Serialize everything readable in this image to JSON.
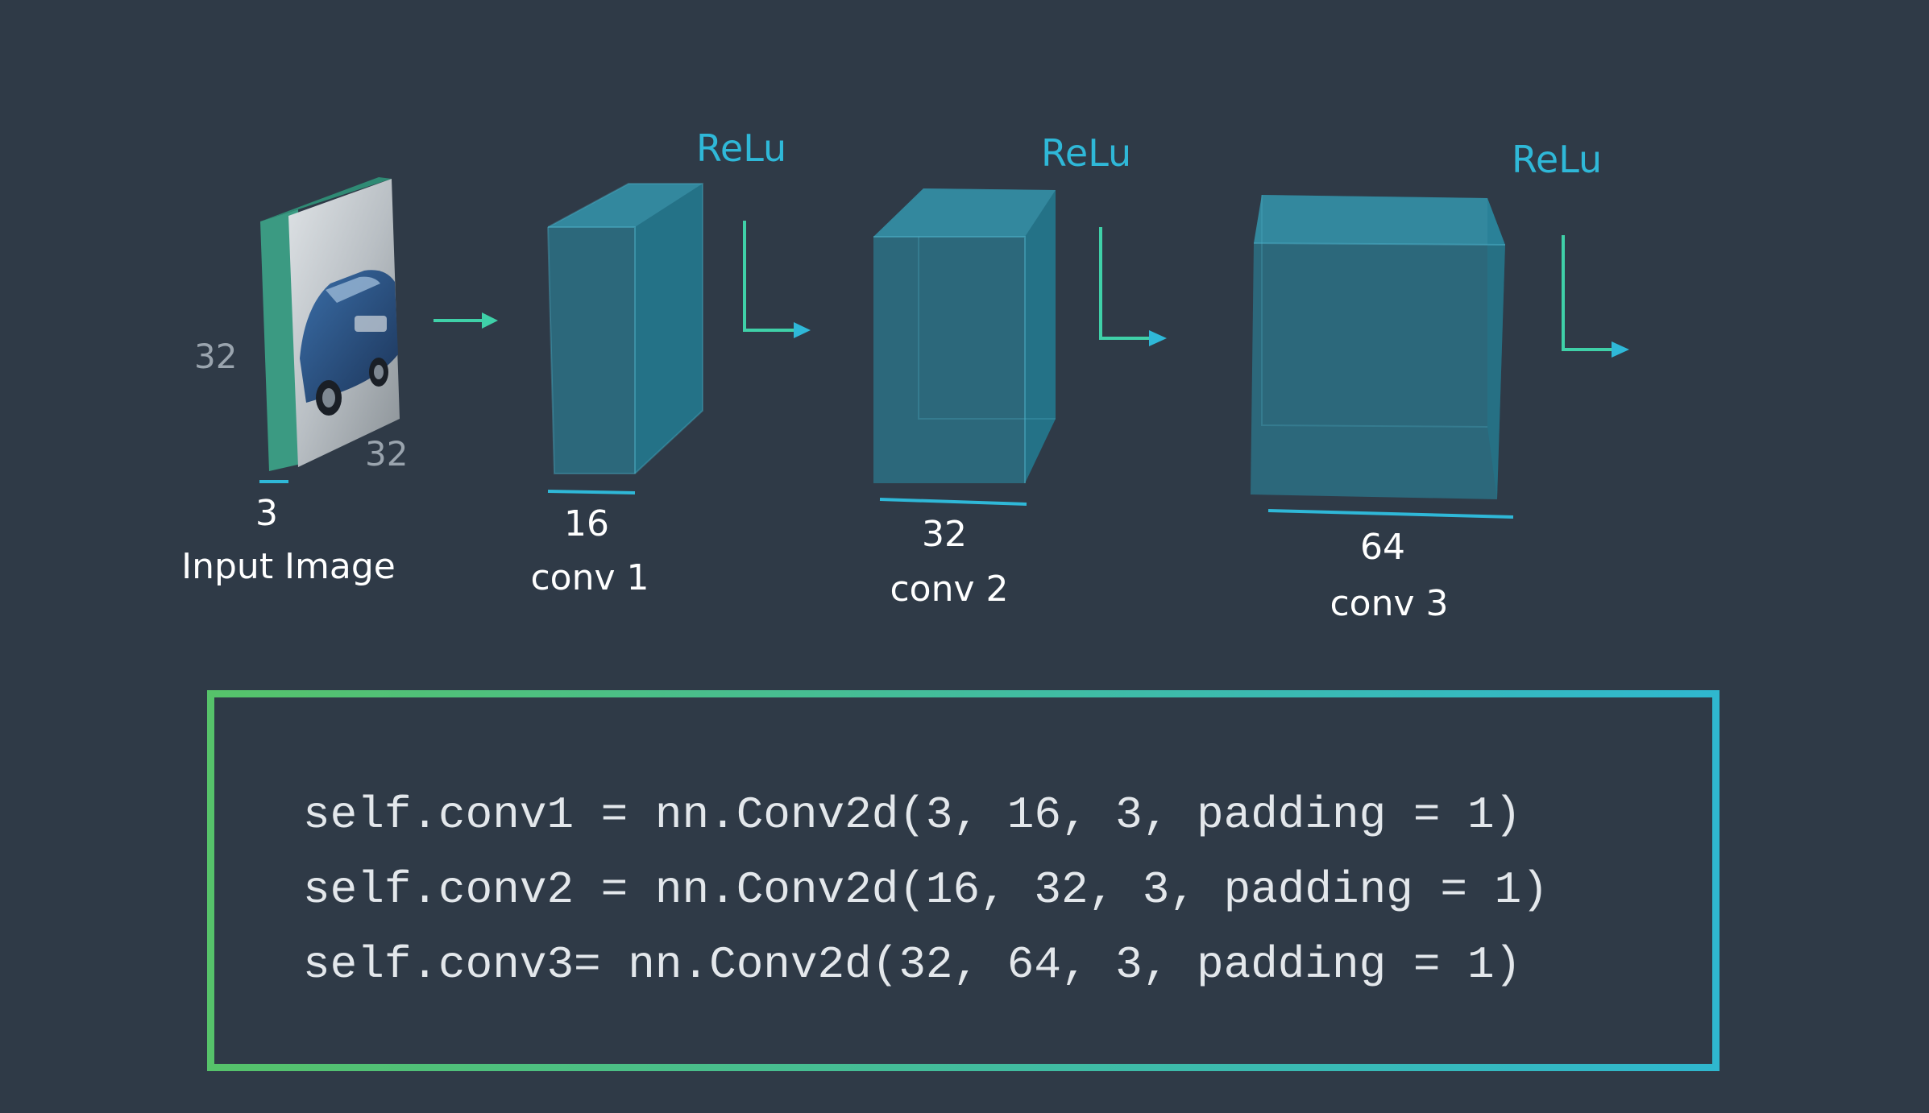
{
  "input": {
    "height_label": "32",
    "width_label": "32",
    "depth_label": "3",
    "name": "Input Image"
  },
  "layers": [
    {
      "depth_label": "16",
      "name": "conv 1",
      "activation": "ReLu"
    },
    {
      "depth_label": "32",
      "name": "conv 2",
      "activation": "ReLu"
    },
    {
      "depth_label": "64",
      "name": "conv 3",
      "activation": "ReLu"
    }
  ],
  "code": {
    "lines": [
      "self.conv1 = nn.Conv2d(3, 16, 3, padding = 1)",
      "self.conv2 = nn.Conv2d(16, 32, 3, padding = 1)",
      "self.conv3= nn.Conv2d(32, 64, 3, padding = 1)"
    ]
  },
  "colors": {
    "background": "#2f3a47",
    "block_face": "#2a8ea6",
    "accent_cyan": "#2fb8d8",
    "arrow_green": "#3fd0a8",
    "border_start": "#56c26a",
    "border_end": "#2fb7cf"
  }
}
